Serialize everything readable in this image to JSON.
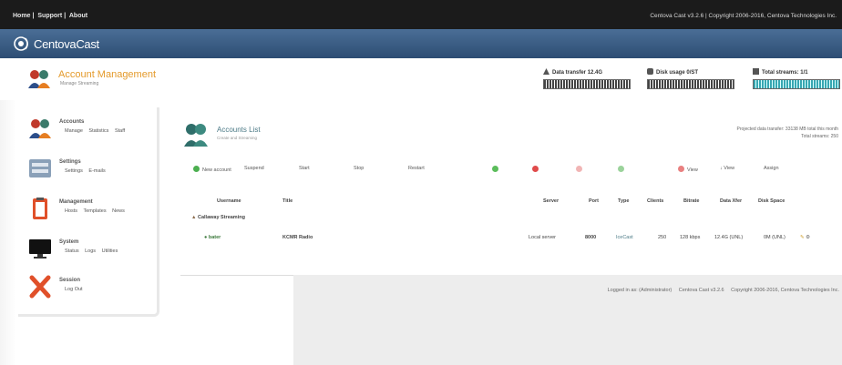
{
  "topbar": {
    "nav": [
      "Home",
      "Support",
      "About"
    ],
    "copyright": "Centova Cast v3.2.6 | Copyright 2006-2016, Centova Technologies Inc."
  },
  "brand": {
    "name": "CentovaCast"
  },
  "account": {
    "title": "Account Management",
    "subtitle": "Manage Streaming"
  },
  "stats": {
    "transfer": {
      "label": "Data transfer",
      "value": "12.4G",
      "fill": 1.0
    },
    "disk": {
      "label": "Disk usage",
      "value": "0/ST",
      "fill": 1.0
    },
    "streams": {
      "label": "Total streams:",
      "value": "1/1",
      "fill": 1.0
    }
  },
  "sidebar": [
    {
      "title": "Accounts",
      "links": [
        "Manage",
        "Statistics",
        "Staff"
      ],
      "icon": "users-icon"
    },
    {
      "title": "Settings",
      "links": [
        "Settings",
        "E-mails"
      ],
      "icon": "settings-icon"
    },
    {
      "title": "Management",
      "links": [
        "Hosts",
        "Templates",
        "News"
      ],
      "icon": "clipboard-icon"
    },
    {
      "title": "System",
      "links": [
        "Status",
        "Logs",
        "Utilities"
      ],
      "icon": "monitor-icon"
    },
    {
      "title": "Session",
      "links": [
        "Log Out"
      ],
      "icon": "logout-x-icon"
    }
  ],
  "list": {
    "title": "Accounts List",
    "subtitle": "Create and Streaming",
    "projected_line1": "Projected data transfer: 33138 MB total this month",
    "projected_line2": "Total streams: 250",
    "new_account": "New account",
    "toolbar_faint": [
      "Suspend",
      "Start",
      "Stop",
      "Restart"
    ],
    "toolbar_view": "View",
    "toolbar_view2": "View",
    "toolbar_more": "Assign"
  },
  "table": {
    "headers": [
      "Username",
      "Title",
      "Server",
      "Port",
      "Type",
      "Clients",
      "Bitrate",
      "Data Xfer",
      "Disk Space"
    ],
    "group": "Callaway Streaming",
    "row": {
      "username": "bater",
      "title": "KCMR Radio",
      "server": "Local server",
      "port": "8000",
      "type": "IceCast",
      "clients": "250",
      "bitrate": "128 kbps",
      "data_xfer": "12.4G (UNL)",
      "disk_space": "0M (UNL)"
    }
  },
  "footer": {
    "logged": "Logged in as: (Administrator)",
    "version": "Centova Cast v3.2.6",
    "copy": "Copyright 2006-2016, Centova Technologies Inc."
  },
  "colors": {
    "accent_orange": "#e49a2b",
    "brand_blue": "#3b5f88",
    "teal": "#4c7a86"
  }
}
